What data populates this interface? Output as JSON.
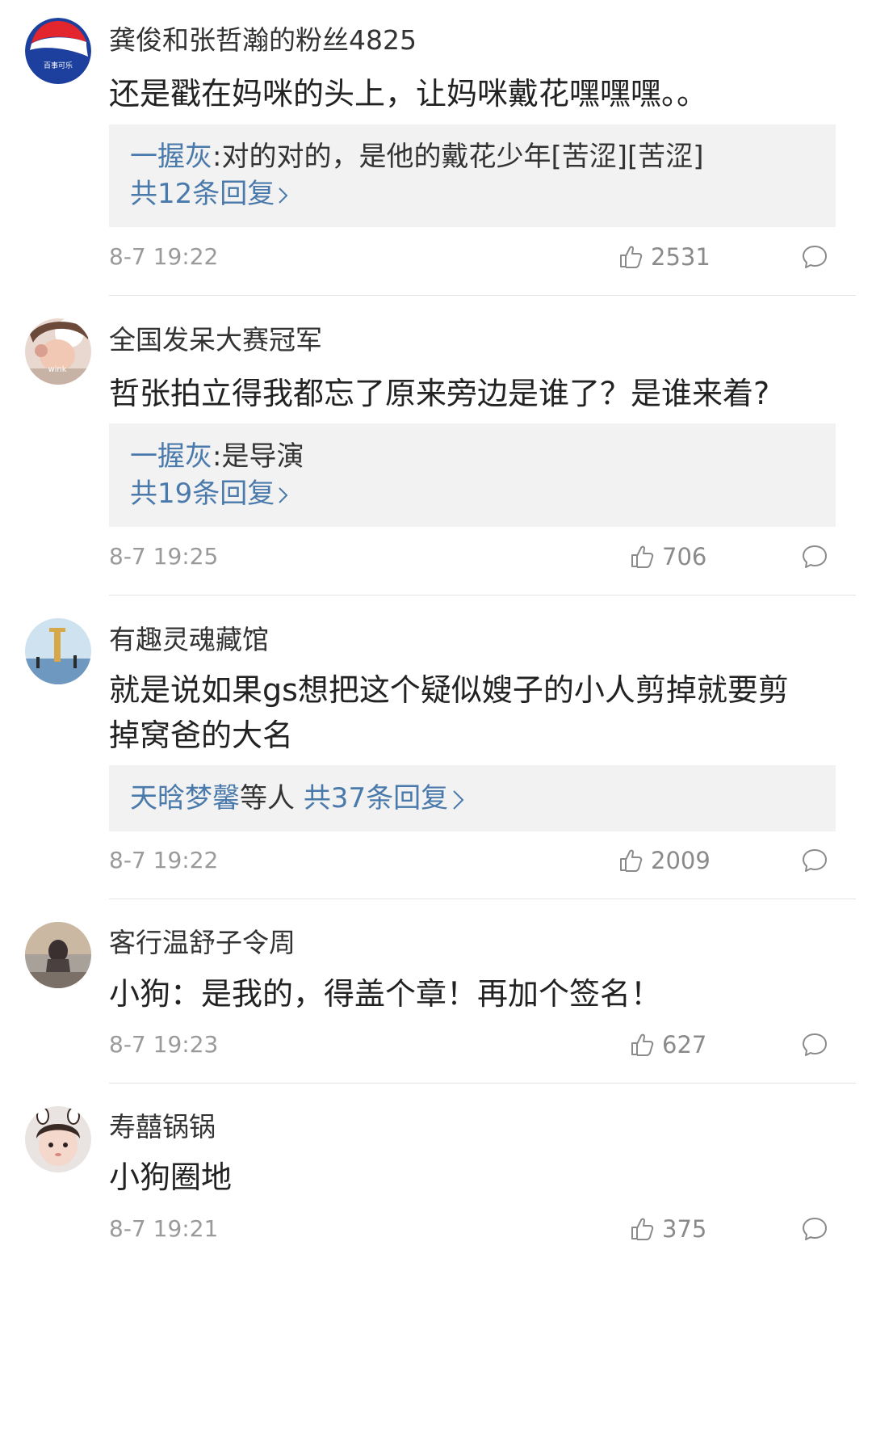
{
  "comments": [
    {
      "username": "龚俊和张哲瀚的粉丝4825",
      "text": "还是戳在妈咪的头上，让妈咪戴花嘿嘿嘿。。",
      "reply_author": "一握灰",
      "reply_text": ":对的对的，是他的戴花少年[苦涩][苦涩]",
      "reply_count_label": "共12条回复",
      "time": "8-7 19:22",
      "likes": "2531",
      "avatar_label": "百事可乐"
    },
    {
      "username": "全国发呆大赛冠军",
      "text": "哲张拍立得我都忘了原来旁边是谁了？是谁来着?",
      "reply_author": "一握灰",
      "reply_text": ":是导演",
      "reply_count_label": "共19条回复",
      "time": "8-7 19:25",
      "likes": "706",
      "avatar_label": "wink"
    },
    {
      "username": "有趣灵魂藏馆",
      "text_line1": "就是说如果gs想把这个疑似嫂子的小人剪掉就要剪",
      "text_line2": "掉窝爸的大名",
      "reply_names": "天晗梦馨",
      "reply_others": "等人",
      "reply_count_label": "共37条回复",
      "time": "8-7 19:22",
      "likes": "2009"
    },
    {
      "username": "客行温舒子令周",
      "text": "小狗：是我的，得盖个章！再加个签名！",
      "time": "8-7 19:23",
      "likes": "627"
    },
    {
      "username": "寿囍锅锅",
      "text": "小狗圈地",
      "time": "8-7 19:21",
      "likes": "375"
    }
  ],
  "icons": {
    "like": "thumbs-up-icon",
    "comment": "speech-bubble-icon",
    "chevron": "chevron-right-icon"
  },
  "colors": {
    "link": "#4a7aab",
    "reply_bg": "#f2f2f2",
    "meta": "#9a9a9a"
  }
}
